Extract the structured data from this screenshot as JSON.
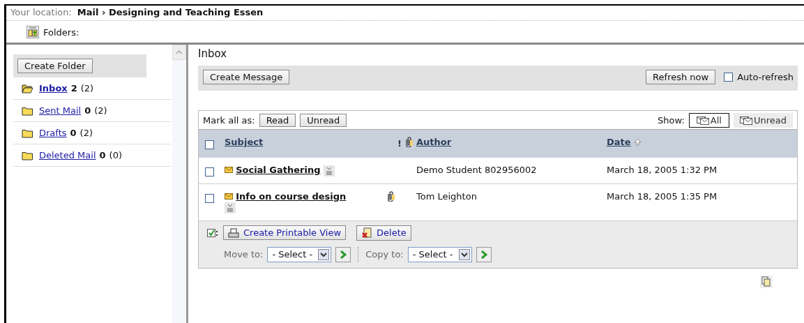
{
  "breadcrumb": {
    "label": "Your location:",
    "path": "Mail › Designing and Teaching Essen"
  },
  "folders_bar": {
    "label": "Folders:"
  },
  "sidebar": {
    "create_button": "Create Folder",
    "folders": [
      {
        "name": "Inbox ",
        "unread": "2",
        "total": "(2)",
        "selected": true
      },
      {
        "name": "Sent Mail",
        "unread": "0",
        "total": "(2)",
        "selected": false
      },
      {
        "name": "Drafts",
        "unread": "0",
        "total": "(2)",
        "selected": false
      },
      {
        "name": "Deleted Mail",
        "unread": "0",
        "total": "(0)",
        "selected": false
      }
    ]
  },
  "main": {
    "title": "Inbox",
    "create_button": "Create Message",
    "refresh_button": "Refresh now",
    "auto_refresh": {
      "label": "Auto-refresh",
      "checked": false
    }
  },
  "mark_bar": {
    "label": "Mark all as:",
    "buttons": [
      "Read",
      "Unread"
    ],
    "show_label": "Show:",
    "show_options": [
      {
        "label": "All",
        "selected": true
      },
      {
        "label": "Unread",
        "selected": false
      }
    ]
  },
  "table": {
    "select_all_checked": false,
    "columns": [
      {
        "label": "Subject",
        "sorted": false
      },
      {
        "label": "!",
        "sorted": false
      },
      {
        "label": "Author",
        "sorted": false
      },
      {
        "label": "Date ",
        "sorted": true
      }
    ],
    "rows": [
      {
        "checked": false,
        "subject": "Social Gathering",
        "has_attachment": false,
        "author": "Demo Student 802956002",
        "date": "March 18, 2005 1:32 PM"
      },
      {
        "checked": false,
        "subject": "Info on course design",
        "has_attachment": true,
        "author": "Tom Leighton",
        "date": "March 18, 2005 1:35 PM"
      }
    ]
  },
  "actions": {
    "printable_button": "Create Printable View",
    "delete_button": "Delete",
    "move_label": "Move to:",
    "move_select": "- Select -",
    "copy_label": "Copy to:",
    "copy_select": "- Select -"
  }
}
